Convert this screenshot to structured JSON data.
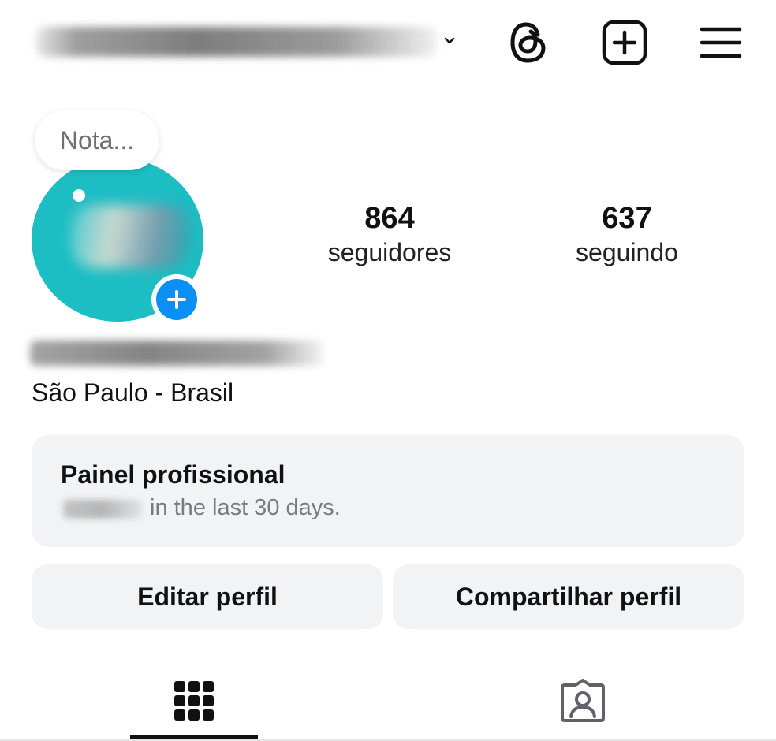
{
  "header": {
    "username": "",
    "icons": [
      "chevron-down-icon",
      "threads-icon",
      "plus-square-icon",
      "menu-icon"
    ]
  },
  "profile": {
    "note_placeholder": "Nota...",
    "name": "",
    "location": "São Paulo - Brasil",
    "avatar_color": "#1dbdc4",
    "add_story_color": "#0a8ff5"
  },
  "stats": {
    "followers": {
      "count": "864",
      "label": "seguidores"
    },
    "following": {
      "count": "637",
      "label": "seguindo"
    }
  },
  "dashboard": {
    "title": "Painel profissional",
    "subtitle": "in the last 30 days."
  },
  "actions": {
    "edit_label": "Editar perfil",
    "share_label": "Compartilhar perfil"
  },
  "tabs": {
    "items": [
      "grid-icon",
      "tagged-icon"
    ],
    "active": "grid-icon"
  }
}
